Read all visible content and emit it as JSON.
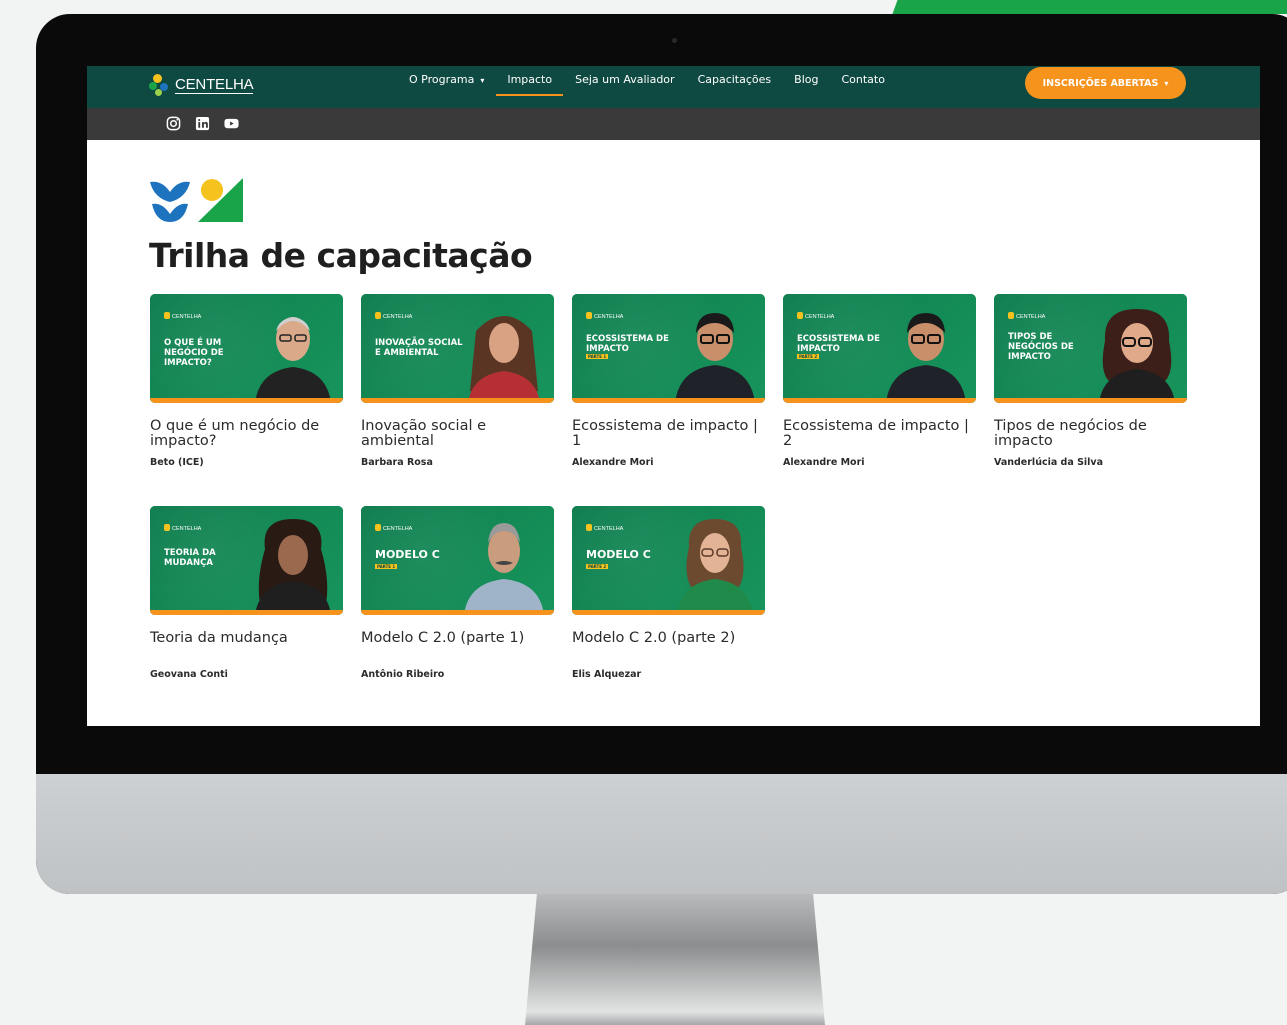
{
  "nav": {
    "brand": "CENTELHA",
    "items": [
      {
        "label": "O Programa",
        "caret": "▾"
      },
      {
        "label": "Impacto"
      },
      {
        "label": "Seja um Avaliador"
      },
      {
        "label": "Capacitações"
      },
      {
        "label": "Blog"
      },
      {
        "label": "Contato"
      }
    ],
    "cta_label": "INSCRIÇÕES ABERTAS",
    "cta_caret": "▾",
    "social": [
      "instagram-icon",
      "linkedin-icon",
      "youtube-icon"
    ]
  },
  "page": {
    "title": "Trilha de capacitação"
  },
  "cards": [
    {
      "title": "O que é um negócio de impacto?",
      "author": "Beto (ICE)",
      "thumb_title": "O QUE É UM NEGÓCIO DE IMPACTO?",
      "thumb_tag": ""
    },
    {
      "title": "Inovação social e ambiental",
      "author": "Barbara Rosa",
      "thumb_title": "INOVAÇÃO SOCIAL E AMBIENTAL",
      "thumb_tag": ""
    },
    {
      "title": "Ecossistema de impacto | 1",
      "author": "Alexandre Mori",
      "thumb_title": "ECOSSISTEMA DE IMPACTO",
      "thumb_tag": "PARTE 1"
    },
    {
      "title": "Ecossistema de impacto | 2",
      "author": "Alexandre Mori",
      "thumb_title": "ECOSSISTEMA DE IMPACTO",
      "thumb_tag": "PARTE 2"
    },
    {
      "title": "Tipos de negócios de impacto",
      "author": "Vanderlúcia da Silva",
      "thumb_title": "TIPOS DE NEGÓCIOS DE IMPACTO",
      "thumb_tag": ""
    },
    {
      "title": "Teoria da mudança",
      "author": "Geovana Conti",
      "thumb_title": "TEORIA DA MUDANÇA",
      "thumb_tag": ""
    },
    {
      "title": "Modelo C 2.0 (parte 1)",
      "author": "Antônio Ribeiro",
      "thumb_title": "MODELO C",
      "thumb_tag": "PARTE 1"
    },
    {
      "title": "Modelo C 2.0 (parte 2)",
      "author": "Elis Alquezar",
      "thumb_title": "MODELO C",
      "thumb_tag": "PARTE 2"
    }
  ],
  "colors": {
    "nav_bg": "#0f4a42",
    "subbar_bg": "#3a3a3a",
    "accent_orange": "#f6931d",
    "thumb_green": "#138a55",
    "brand_blue": "#1e73be",
    "brand_yellow": "#f6c21d",
    "brand_green": "#1aa44a"
  }
}
